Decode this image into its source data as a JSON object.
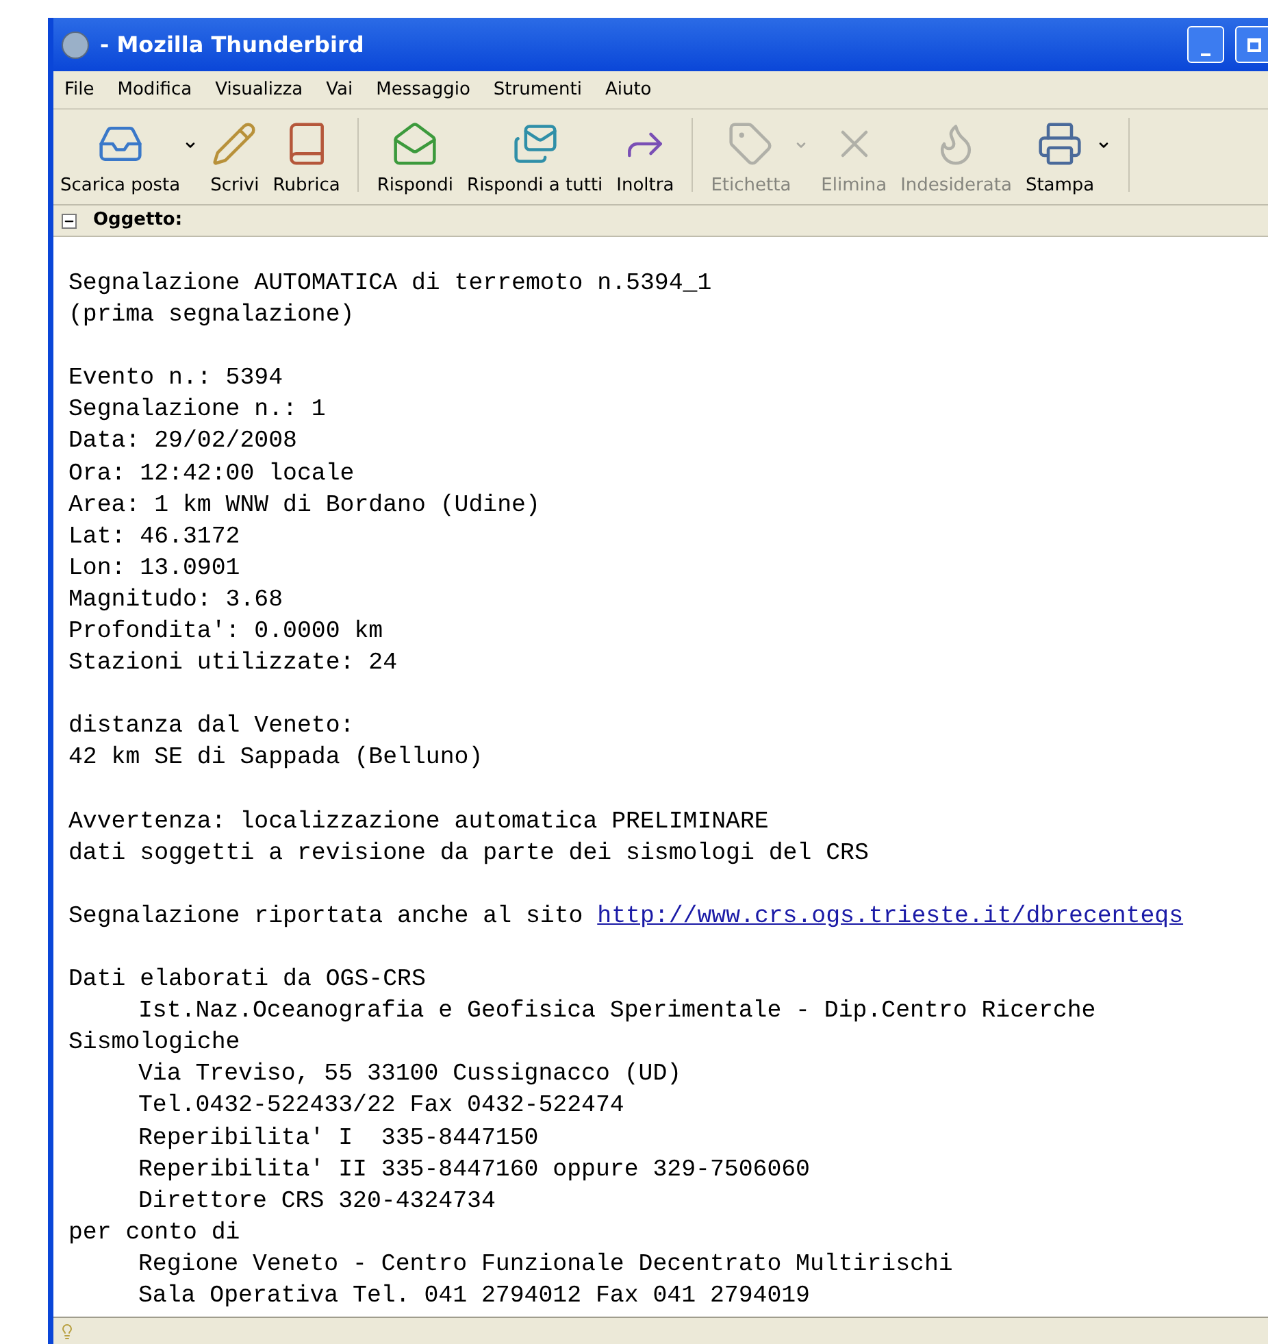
{
  "window": {
    "title": "- Mozilla Thunderbird"
  },
  "menu": [
    "File",
    "Modifica",
    "Visualizza",
    "Vai",
    "Messaggio",
    "Strumenti",
    "Aiuto"
  ],
  "toolbar": [
    {
      "label": "Scarica posta",
      "disabled": false,
      "has_menu": true,
      "separator_after": false
    },
    {
      "label": "Scrivi",
      "disabled": false,
      "has_menu": false,
      "separator_after": false
    },
    {
      "label": "Rubrica",
      "disabled": false,
      "has_menu": false,
      "separator_after": true
    },
    {
      "label": "Rispondi",
      "disabled": false,
      "has_menu": false,
      "separator_after": false
    },
    {
      "label": "Rispondi a tutti",
      "disabled": false,
      "has_menu": false,
      "separator_after": false
    },
    {
      "label": "Inoltra",
      "disabled": false,
      "has_menu": false,
      "separator_after": true
    },
    {
      "label": "Etichetta",
      "disabled": true,
      "has_menu": true,
      "separator_after": false
    },
    {
      "label": "Elimina",
      "disabled": true,
      "has_menu": false,
      "separator_after": false
    },
    {
      "label": "Indesiderata",
      "disabled": true,
      "has_menu": false,
      "separator_after": false
    },
    {
      "label": "Stampa",
      "disabled": false,
      "has_menu": true,
      "separator_after": true
    }
  ],
  "header": {
    "label": "Oggetto:",
    "expanded": true
  },
  "body": [
    [
      {
        "text": "Segnalazione AUTOMATICA di terremoto n.5394_1",
        "indented": false
      },
      {
        "text": "(prima segnalazione)",
        "indented": false
      }
    ],
    [
      {
        "text": "Evento n.: 5394",
        "indented": false
      },
      {
        "text": "Segnalazione n.: 1",
        "indented": false
      },
      {
        "text": "Data: 29/02/2008",
        "indented": false
      },
      {
        "text": "Ora: 12:42:00 locale",
        "indented": false
      },
      {
        "text": "Area: 1 km WNW di Bordano (Udine)",
        "indented": false
      },
      {
        "text": "Lat: 46.3172",
        "indented": false
      },
      {
        "text": "Lon: 13.0901",
        "indented": false
      },
      {
        "text": "Magnitudo: 3.68",
        "indented": false
      },
      {
        "text": "Profondita': 0.0000 km",
        "indented": false
      },
      {
        "text": "Stazioni utilizzate: 24",
        "indented": false
      }
    ],
    [
      {
        "text": "distanza dal Veneto:",
        "indented": false
      },
      {
        "text": "42 km SE di Sappada (Belluno)",
        "indented": false
      }
    ],
    [
      {
        "text": "Avvertenza: localizzazione automatica PRELIMINARE",
        "indented": false
      },
      {
        "text": "dati soggetti a revisione da parte dei sismologi del CRS",
        "indented": false
      }
    ],
    [
      {
        "text": "Segnalazione riportata anche al sito ",
        "link": "http://www.crs.ogs.trieste.it/dbrecenteqs",
        "indented": false
      }
    ],
    [
      {
        "text": "Dati elaborati da OGS-CRS",
        "indented": false
      },
      {
        "text": "Ist.Naz.Oceanografia e Geofisica Sperimentale - Dip.Centro Ricerche",
        "indented": true
      },
      {
        "text": "Sismologiche",
        "indented": false
      },
      {
        "text": "Via Treviso, 55 33100 Cussignacco (UD)",
        "indented": true
      },
      {
        "text": "Tel.0432-522433/22 Fax 0432-522474",
        "indented": true
      },
      {
        "text": "Reperibilita' I  335-8447150",
        "indented": true
      },
      {
        "text": "Reperibilita' II 335-8447160 oppure 329-7506060",
        "indented": true
      },
      {
        "text": "Direttore CRS 320-4324734",
        "indented": true
      },
      {
        "text": "per conto di",
        "indented": false
      },
      {
        "text": "Regione Veneto - Centro Funzionale Decentrato Multirischi",
        "indented": true
      },
      {
        "text": "Sala Operativa Tel. 041 2794012 Fax 041 2794019",
        "indented": true
      }
    ]
  ]
}
